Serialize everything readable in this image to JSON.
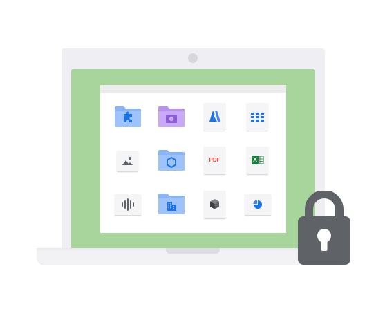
{
  "illustration": {
    "description_colors": {
      "screen": "#a8d59c",
      "lock": "#5f6368",
      "folder_blue": "#8ab4f8",
      "folder_purple": "#c5a6f5"
    }
  },
  "files": [
    {
      "icon": "puzzle-folder-icon"
    },
    {
      "icon": "photo-folder-icon"
    },
    {
      "icon": "brand-a-file-icon"
    },
    {
      "icon": "grid-file-icon"
    },
    {
      "icon": "image-file-icon"
    },
    {
      "icon": "hexagon-folder-icon"
    },
    {
      "icon": "pdf-file-icon",
      "label": "PDF"
    },
    {
      "icon": "excel-file-icon",
      "label": "X"
    },
    {
      "icon": "audio-file-icon"
    },
    {
      "icon": "building-folder-icon"
    },
    {
      "icon": "cube-file-icon"
    },
    {
      "icon": "pie-chart-file-icon"
    }
  ]
}
